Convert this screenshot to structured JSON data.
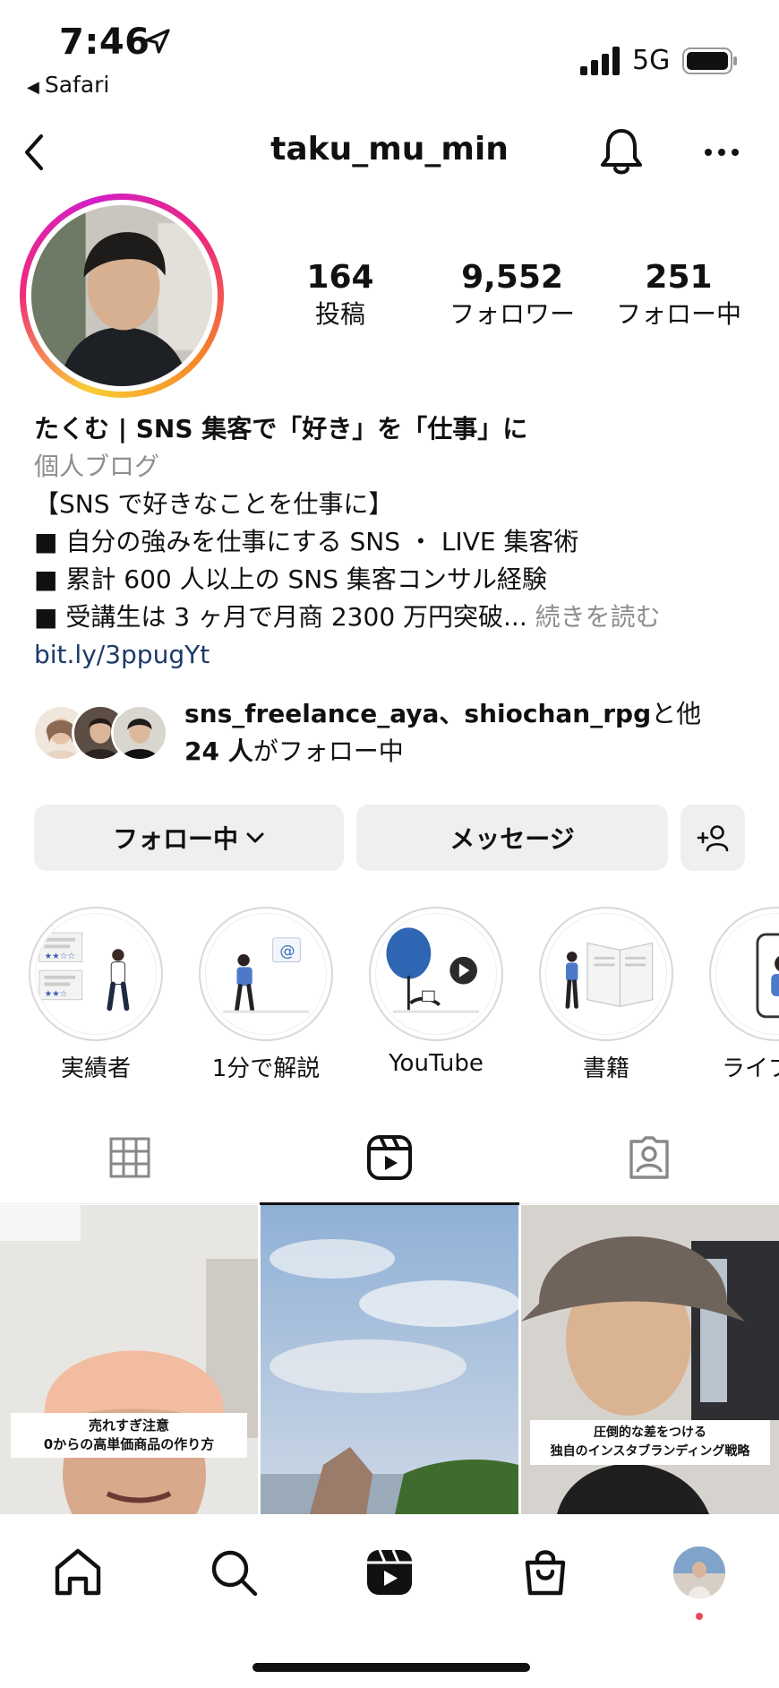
{
  "status_bar": {
    "time": "7:46",
    "back_app": "Safari",
    "network": "5G"
  },
  "header": {
    "username": "taku_mu_min"
  },
  "profile": {
    "stats": [
      {
        "value": "164",
        "label": "投稿"
      },
      {
        "value": "9,552",
        "label": "フォロワー"
      },
      {
        "value": "251",
        "label": "フォロー中"
      }
    ],
    "bio": {
      "name": "たくむ | SNS 集客で「好き」を「仕事」に",
      "category": "個人ブログ",
      "lines": [
        "【SNS で好きなことを仕事に】",
        "■ 自分の強みを仕事にする SNS ・ LIVE 集客術",
        "■ 累計 600 人以上の SNS 集客コンサル経験",
        "■ 受講生は 3 ヶ月で月商 2300 万円突破..."
      ],
      "read_more": "続きを読む",
      "link": "bit.ly/3ppugYt"
    },
    "followed_by": {
      "names": "sns_freelance_aya、shiochan_rpg",
      "mid": "と他",
      "count": "24 人",
      "suffix": "がフォロー中"
    }
  },
  "buttons": {
    "following": "フォロー中",
    "message": "メッセージ"
  },
  "highlights": [
    {
      "label": "実績者"
    },
    {
      "label": "1分で解説"
    },
    {
      "label": "YouTube"
    },
    {
      "label": "書籍"
    },
    {
      "label": "ライブ"
    }
  ],
  "tabs": [
    {
      "name": "posts-grid",
      "active": false
    },
    {
      "name": "reels",
      "active": true
    },
    {
      "name": "tagged",
      "active": false
    }
  ],
  "posts": [
    {
      "caption_lines": [
        "売れすぎ注意",
        "0からの高単価商品の作り方"
      ]
    },
    {
      "caption_lines": []
    },
    {
      "caption_lines": [
        "圧倒的な差をつける",
        "独自のインスタブランディング戦略"
      ]
    }
  ],
  "colors": {
    "link": "#1d3a6b",
    "secondary_text": "#8e8e8e",
    "button_bg": "#efefef",
    "notification_dot": "#ed4956"
  },
  "icons": [
    "location-arrow-icon",
    "signal-icon",
    "battery-icon",
    "back-chevron-icon",
    "bell-icon",
    "more-icon",
    "chevron-down-icon",
    "add-person-icon",
    "grid-icon",
    "reels-icon",
    "tagged-icon",
    "home-icon",
    "search-icon",
    "shop-icon"
  ]
}
